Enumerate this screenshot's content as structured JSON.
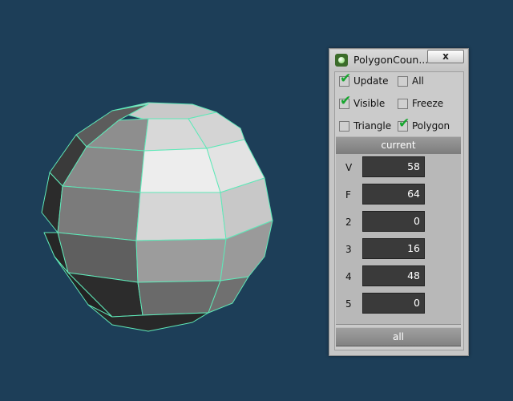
{
  "window": {
    "title": "PolygonCoun...",
    "close_label": "x"
  },
  "options": {
    "update": {
      "label": "Update",
      "checked": true
    },
    "all": {
      "label": "All",
      "checked": false
    },
    "visible": {
      "label": "Visible",
      "checked": true
    },
    "freeze": {
      "label": "Freeze",
      "checked": false
    },
    "triangle": {
      "label": "Triangle",
      "checked": false
    },
    "polygon": {
      "label": "Polygon",
      "checked": true
    }
  },
  "current_header": "current",
  "stats": [
    {
      "label": "V",
      "value": "58"
    },
    {
      "label": "F",
      "value": "64"
    },
    {
      "label": "2",
      "value": "0"
    },
    {
      "label": "3",
      "value": "16"
    },
    {
      "label": "4",
      "value": "48"
    },
    {
      "label": "5",
      "value": "0"
    }
  ],
  "all_button": "all",
  "colors": {
    "viewport_bg": "#1d3e58",
    "wireframe": "#5fe8b8",
    "check": "#17a62f"
  }
}
